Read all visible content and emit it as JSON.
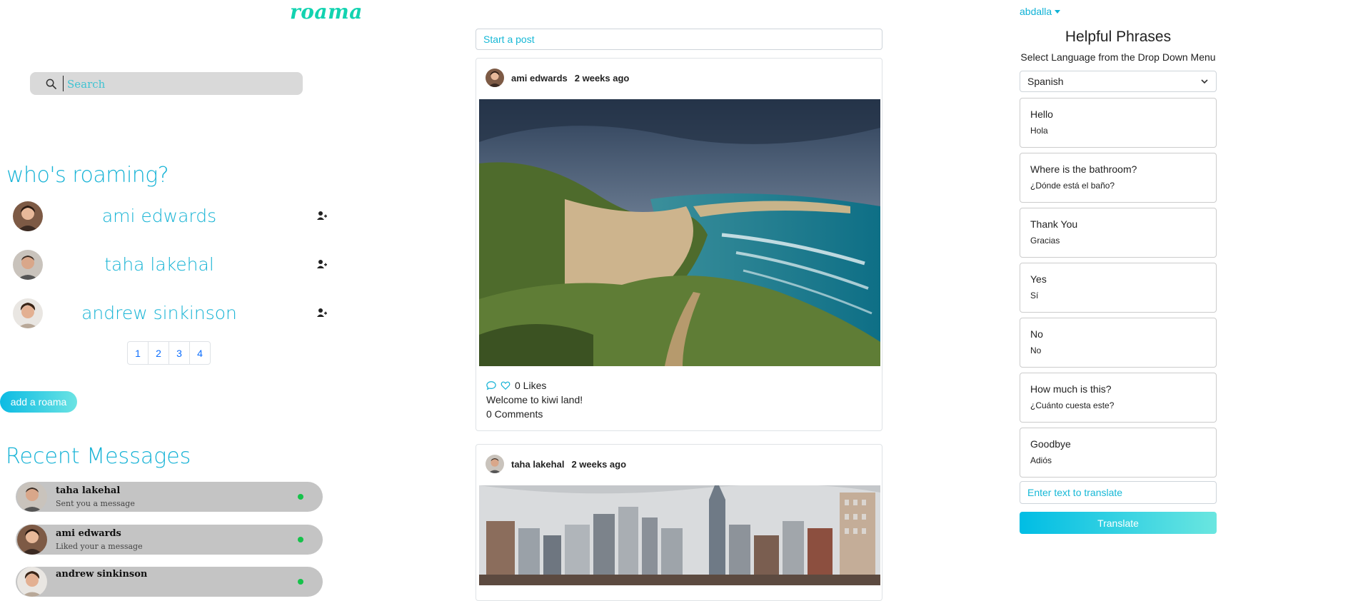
{
  "brand": {
    "logo": "roama"
  },
  "search": {
    "placeholder": "Search"
  },
  "whos_roaming": {
    "title": "who's roaming?",
    "users": [
      {
        "name": "ami edwards"
      },
      {
        "name": "taha lakehal"
      },
      {
        "name": "andrew sinkinson"
      }
    ],
    "pages": [
      "1",
      "2",
      "3",
      "4"
    ]
  },
  "add_roama": {
    "label": "add a roama"
  },
  "recent_messages": {
    "title": "Recent Messages",
    "items": [
      {
        "name": "taha lakehal",
        "text": "Sent you a message"
      },
      {
        "name": "ami edwards",
        "text": "Liked your a message"
      },
      {
        "name": "andrew sinkinson",
        "text": ""
      }
    ]
  },
  "feed": {
    "start_post": "Start a post",
    "posts": [
      {
        "author": "ami edwards",
        "time": "2 weeks ago",
        "likes": "0 Likes",
        "caption": "Welcome to kiwi land!",
        "comments": "0 Comments"
      },
      {
        "author": "taha lakehal",
        "time": "2 weeks ago"
      }
    ]
  },
  "user_menu": {
    "username": "abdalla"
  },
  "helpful_phrases": {
    "title": "Helpful Phrases",
    "subtitle": "Select Language from the Drop Down Menu",
    "selected_language": "Spanish",
    "phrases": [
      {
        "en": "Hello",
        "tr": "Hola"
      },
      {
        "en": "Where is the bathroom?",
        "tr": "¿Dónde está el baño?"
      },
      {
        "en": "Thank You",
        "tr": "Gracias"
      },
      {
        "en": "Yes",
        "tr": "Sí"
      },
      {
        "en": "No",
        "tr": "No"
      },
      {
        "en": "How much is this?",
        "tr": "¿Cuánto cuesta este?"
      },
      {
        "en": "Goodbye",
        "tr": "Adiós"
      }
    ],
    "translate_placeholder": "Enter text to translate",
    "translate_label": "Translate"
  },
  "colors": {
    "accent": "#17b3d6",
    "logo": "#12d3b0",
    "online": "#16c24a"
  }
}
